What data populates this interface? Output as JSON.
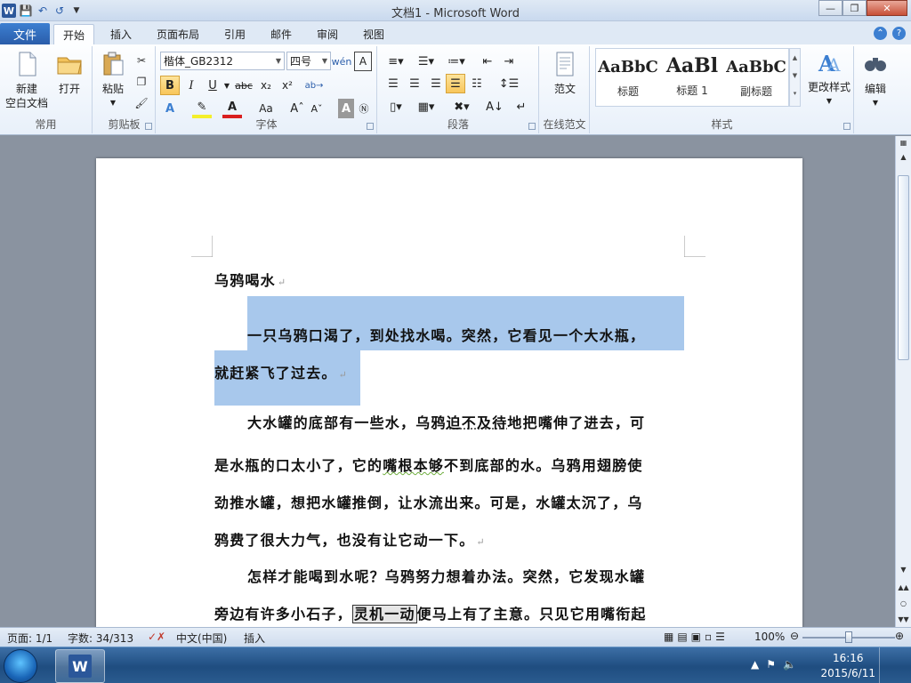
{
  "window": {
    "title": "文档1 - Microsoft Word",
    "minimize": "—",
    "restore": "❐",
    "close": "✕"
  },
  "ribbon_tabs": [
    "文件",
    "开始",
    "插入",
    "页面布局",
    "引用",
    "邮件",
    "审阅",
    "视图"
  ],
  "ribbon": {
    "common": {
      "new_label": "新建",
      "new_label2": "空白文档",
      "open_label": "打开",
      "group": "常用"
    },
    "clipboard": {
      "paste_label": "粘贴",
      "group": "剪贴板"
    },
    "font": {
      "font_name": "楷体_GB2312",
      "font_size": "四号",
      "group": "字体"
    },
    "paragraph": {
      "group": "段落"
    },
    "online": {
      "sample_label": "范文",
      "group": "在线范文"
    },
    "styles": {
      "group": "样式",
      "items": [
        {
          "sample": "AaBbC",
          "name": "标题"
        },
        {
          "sample": "AaBl",
          "name": "标题 1"
        },
        {
          "sample": "AaBbC",
          "name": "副标题"
        }
      ],
      "change_label": "更改样式",
      "edit_label": "编辑"
    }
  },
  "document": {
    "title": "乌鸦喝水",
    "p1_line1": "一只乌鸦口渴了，到处找水喝。突然，它看见一个大水瓶，",
    "p1_line2": "就赶紧飞了过去。",
    "p2_line1_a": "大水罐的底部有一些水，乌鸦",
    "p2_line1_b": "迫不及待",
    "p2_line1_c": "地把嘴伸了进去，可",
    "p2_line2_a": "是水瓶的口太小了，它的",
    "p2_line2_b": "嘴根本够",
    "p2_line2_c": "不到底部的水。乌鸦用翅膀使",
    "p2_line3": "劲推水罐，想把水罐推倒，让水流出来。可是，水罐太沉了，乌",
    "p2_line4": "鸦费了很大力气，也没有让它动一下。",
    "p3_line1": "怎样才能喝到水呢？乌鸦努力想着办法。突然，它发现水罐",
    "p3_line2_a": "旁边有许多小石子，",
    "p3_line2_b": "灵机一动",
    "p3_line2_c": "便马上有了主意。只见它用嘴衔起",
    "para_mark": "↵"
  },
  "statusbar": {
    "page": "页面: 1/1",
    "words": "字数: 34/313",
    "language": "中文(中国)",
    "mode": "插入",
    "zoom": "100%",
    "zoom_level": 100
  },
  "taskbar": {
    "time": "16:16",
    "date": "2015/6/11"
  },
  "colors": {
    "selection": "#a8c8ec",
    "file_tab": "#2a5daa",
    "word_blue": "#2b579a"
  }
}
